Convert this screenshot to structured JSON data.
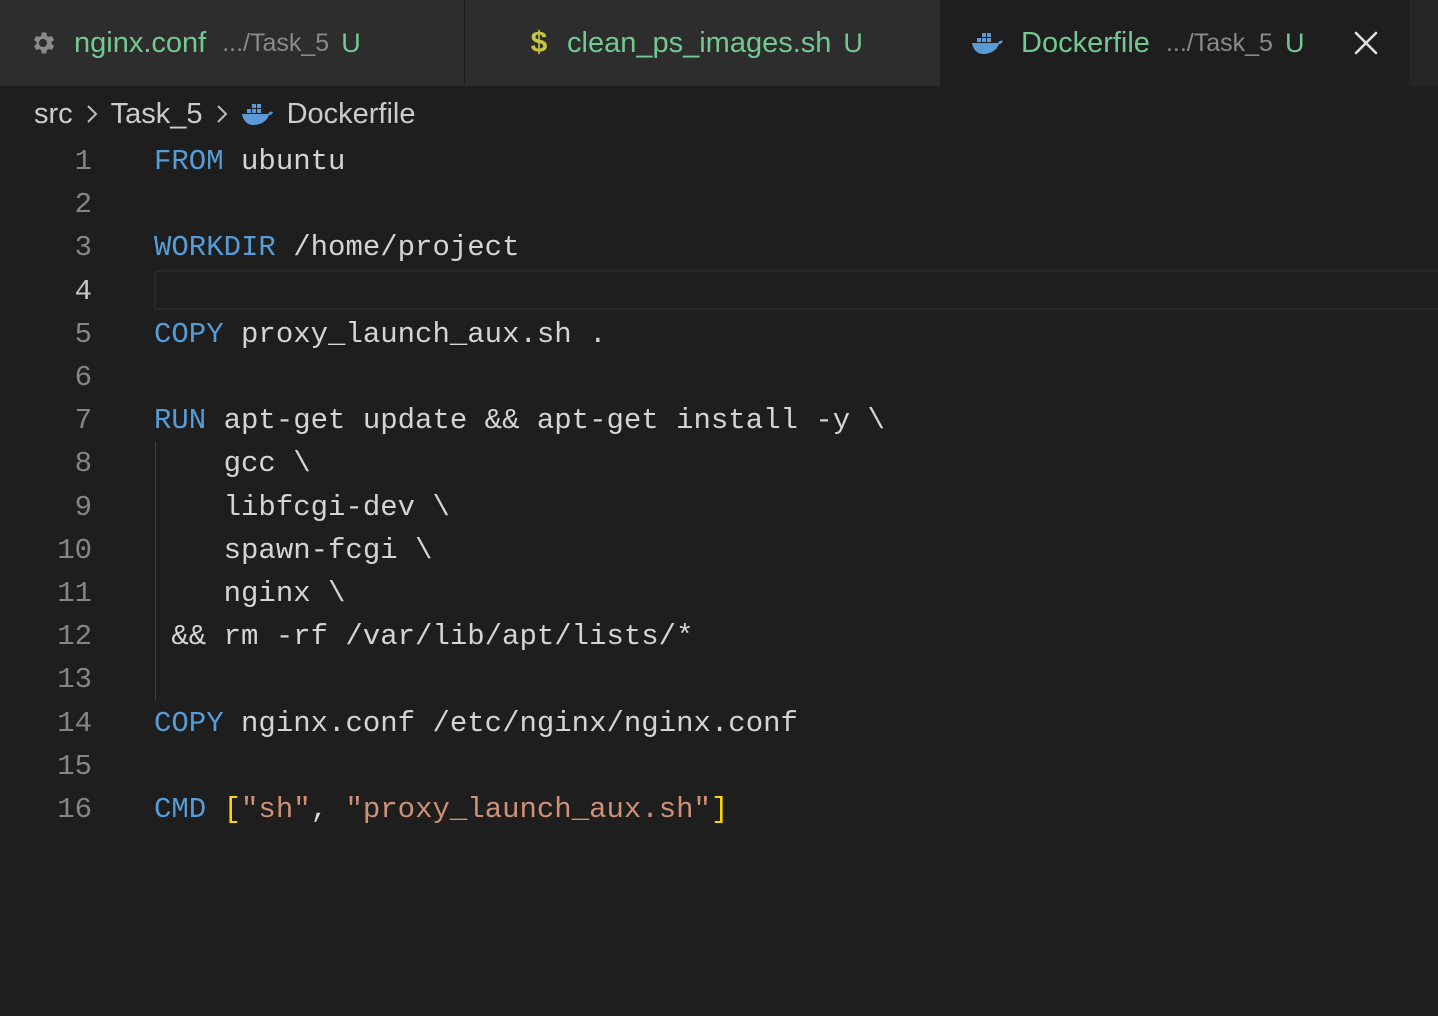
{
  "tabs": [
    {
      "icon": "gear-icon",
      "name": "nginx.conf",
      "path": ".../Task_5",
      "status": "U"
    },
    {
      "icon": "dollar-icon",
      "name": "clean_ps_images.sh",
      "path": "",
      "status": "U"
    },
    {
      "icon": "docker-whale-icon",
      "name": "Dockerfile",
      "path": ".../Task_5",
      "status": "U",
      "active": true
    }
  ],
  "breadcrumb": {
    "items": [
      "src",
      "Task_5",
      "Dockerfile"
    ]
  },
  "editor": {
    "active_line": 4,
    "lines": [
      {
        "n": "1",
        "kw": "FROM",
        "rest": " ubuntu"
      },
      {
        "n": "2",
        "kw": "",
        "rest": ""
      },
      {
        "n": "3",
        "kw": "WORKDIR",
        "rest": " /home/project"
      },
      {
        "n": "4",
        "kw": "",
        "rest": ""
      },
      {
        "n": "5",
        "kw": "COPY",
        "rest": " proxy_launch_aux.sh ."
      },
      {
        "n": "6",
        "kw": "",
        "rest": ""
      },
      {
        "n": "7",
        "kw": "RUN",
        "rest": " apt-get update && apt-get install -y \\"
      },
      {
        "n": "8",
        "kw": "",
        "rest": "    gcc \\"
      },
      {
        "n": "9",
        "kw": "",
        "rest": "    libfcgi-dev \\"
      },
      {
        "n": "10",
        "kw": "",
        "rest": "    spawn-fcgi \\"
      },
      {
        "n": "11",
        "kw": "",
        "rest": "    nginx \\"
      },
      {
        "n": "12",
        "kw": "",
        "rest": " && rm -rf /var/lib/apt/lists/*"
      },
      {
        "n": "13",
        "kw": "",
        "rest": ""
      },
      {
        "n": "14",
        "kw": "COPY",
        "rest": " nginx.conf /etc/nginx/nginx.conf"
      },
      {
        "n": "15",
        "kw": "",
        "rest": ""
      },
      {
        "n": "16",
        "kw": "CMD",
        "rest": "",
        "cmd": {
          "open": "[",
          "a": "\"sh\"",
          "comma": ", ",
          "b": "\"proxy_launch_aux.sh\"",
          "close": "]"
        }
      }
    ]
  },
  "colors": {
    "keyword": "#569cd6",
    "string": "#ce9178",
    "bracket": "#ffd700",
    "untracked": "#73c991",
    "background": "#1e1e1e"
  }
}
